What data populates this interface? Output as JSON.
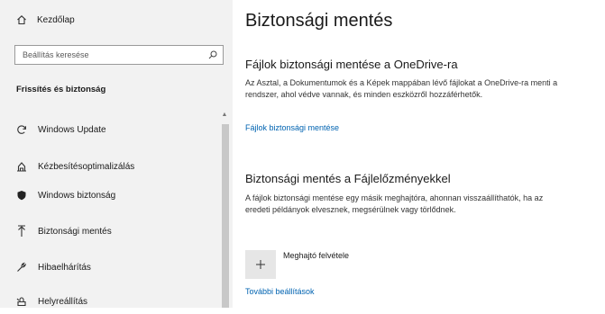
{
  "sidebar": {
    "home_label": "Kezdőlap",
    "search_placeholder": "Beállítás keresése",
    "section_title": "Frissítés és biztonság",
    "items": [
      {
        "label": "Windows Update",
        "icon": "sync-icon"
      },
      {
        "label": "Kézbesítésoptimalizálás",
        "icon": "delivery-optimization-icon"
      },
      {
        "label": "Windows biztonság",
        "icon": "shield-icon"
      },
      {
        "label": "Biztonsági mentés",
        "icon": "backup-icon",
        "selected": true
      },
      {
        "label": "Hibaelhárítás",
        "icon": "wrench-icon"
      },
      {
        "label": "Helyreállítás",
        "icon": "recovery-icon"
      }
    ]
  },
  "main": {
    "title": "Biztonsági mentés",
    "onedrive": {
      "heading": "Fájlok biztonsági mentése a OneDrive-ra",
      "description": "Az Asztal, a Dokumentumok és a Képek mappában lévő fájlokat a OneDrive-ra menti a rendszer, ahol védve vannak, és minden eszközről hozzáférhetők.",
      "link": "Fájlok biztonsági mentése"
    },
    "file_history": {
      "heading": "Biztonsági mentés a Fájlelőzményekkel",
      "description": "A fájlok biztonsági mentése egy másik meghajtóra, ahonnan visszaállíthatók, ha az eredeti példányok elvesznek, megsérülnek vagy törlődnek.",
      "add_drive_label": "Meghajtó felvétele",
      "more_options_link": "További beállítások"
    }
  },
  "colors": {
    "sidebar_bg": "#f2f2f2",
    "link": "#0063b1",
    "add_button_bg": "#e6e6e6"
  }
}
